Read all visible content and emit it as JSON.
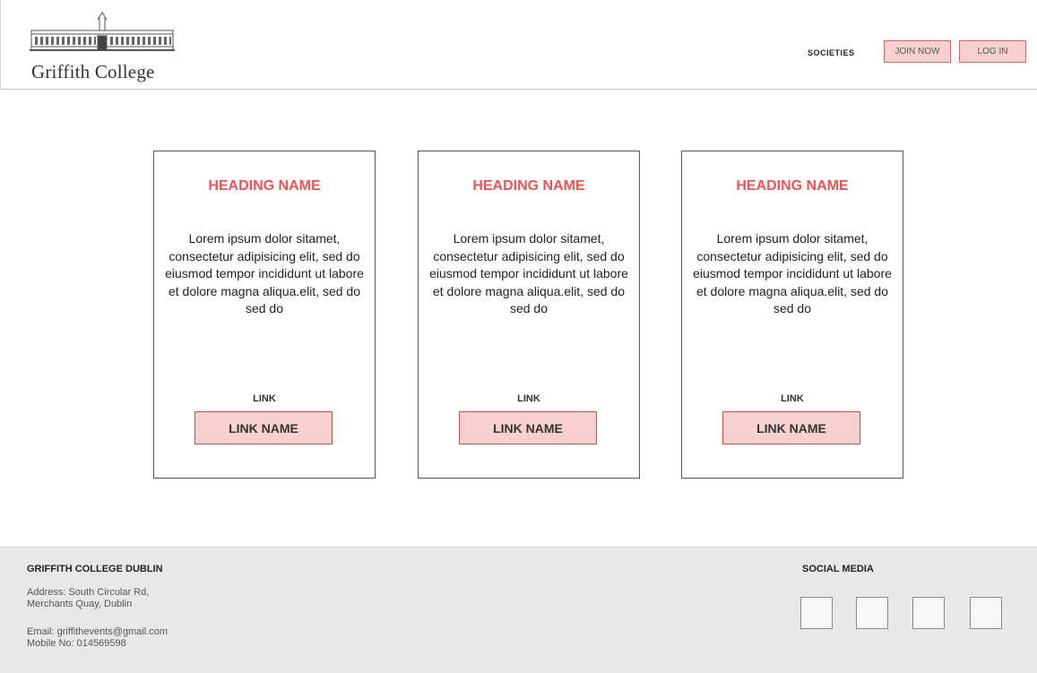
{
  "header": {
    "logo_text": "Griffith College",
    "nav": {
      "societies": "SOCIETIES",
      "join": "JOIN NOW",
      "login": "LOG IN"
    }
  },
  "cards": [
    {
      "heading": "HEADING NAME",
      "body": "Lorem ipsum dolor sitamet, consectetur adipisicing elit, sed do eiusmod tempor incididunt ut labore et dolore magna aliqua.elit, sed do sed do",
      "link_label": "LINK",
      "link_button": "LINK NAME"
    },
    {
      "heading": "HEADING NAME",
      "body": "Lorem ipsum dolor sitamet, consectetur adipisicing elit, sed do eiusmod tempor incididunt ut labore et dolore magna aliqua.elit, sed do sed do",
      "link_label": "LINK",
      "link_button": "LINK NAME"
    },
    {
      "heading": "HEADING NAME",
      "body": "Lorem ipsum dolor sitamet, consectetur adipisicing elit, sed do eiusmod tempor incididunt ut labore et dolore magna aliqua.elit, sed do sed do",
      "link_label": "LINK",
      "link_button": "LINK NAME"
    }
  ],
  "footer": {
    "title": "GRIFFITH COLLEGE DUBLIN",
    "address_line1": "Address: South Circular Rd,",
    "address_line2": "Merchants Quay, Dublin",
    "email": "Email: griffithevents@gmail.com",
    "mobile": "Mobile No: 014569598",
    "social_title": "SOCIAL MEDIA",
    "social_icons": [
      "social-icon-1",
      "social-icon-2",
      "social-icon-3",
      "social-icon-4"
    ]
  },
  "colors": {
    "heading": "#f05152",
    "button_fill": "#f7d0cf",
    "button_border": "#c0504d",
    "footer_bg": "#e8e8e8"
  }
}
